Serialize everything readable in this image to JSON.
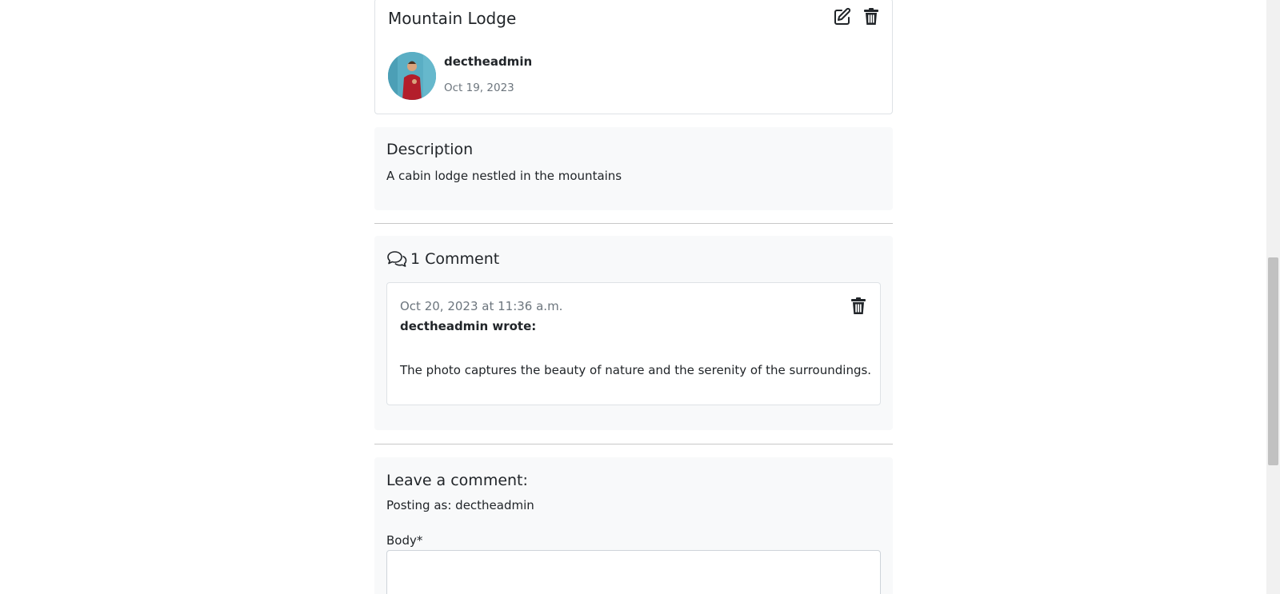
{
  "post": {
    "title": "Mountain Lodge",
    "author": "dectheadmin",
    "date": "Oct 19, 2023",
    "edit_icon": "edit-icon",
    "delete_icon": "trash-icon"
  },
  "description": {
    "heading": "Description",
    "text": "A cabin lodge nestled in the mountains"
  },
  "comments": {
    "icon": "comments-icon",
    "count_label": "1 Comment",
    "items": [
      {
        "date": "Oct 20, 2023 at 11:36 a.m.",
        "author_line": "dectheadmin wrote:",
        "body": "The photo captures the beauty of nature and the serenity of the surroundings.",
        "delete_icon": "trash-icon"
      }
    ]
  },
  "comment_form": {
    "heading": "Leave a comment:",
    "posting_as": "Posting as: dectheadmin",
    "body_label": "Body*",
    "body_value": ""
  },
  "colors": {
    "panel_bg": "#f8f9fa",
    "border": "#dee2e6",
    "muted_text": "#6c757d",
    "avatar_bg": "#5aaec4",
    "shirt": "#b31e2b"
  }
}
